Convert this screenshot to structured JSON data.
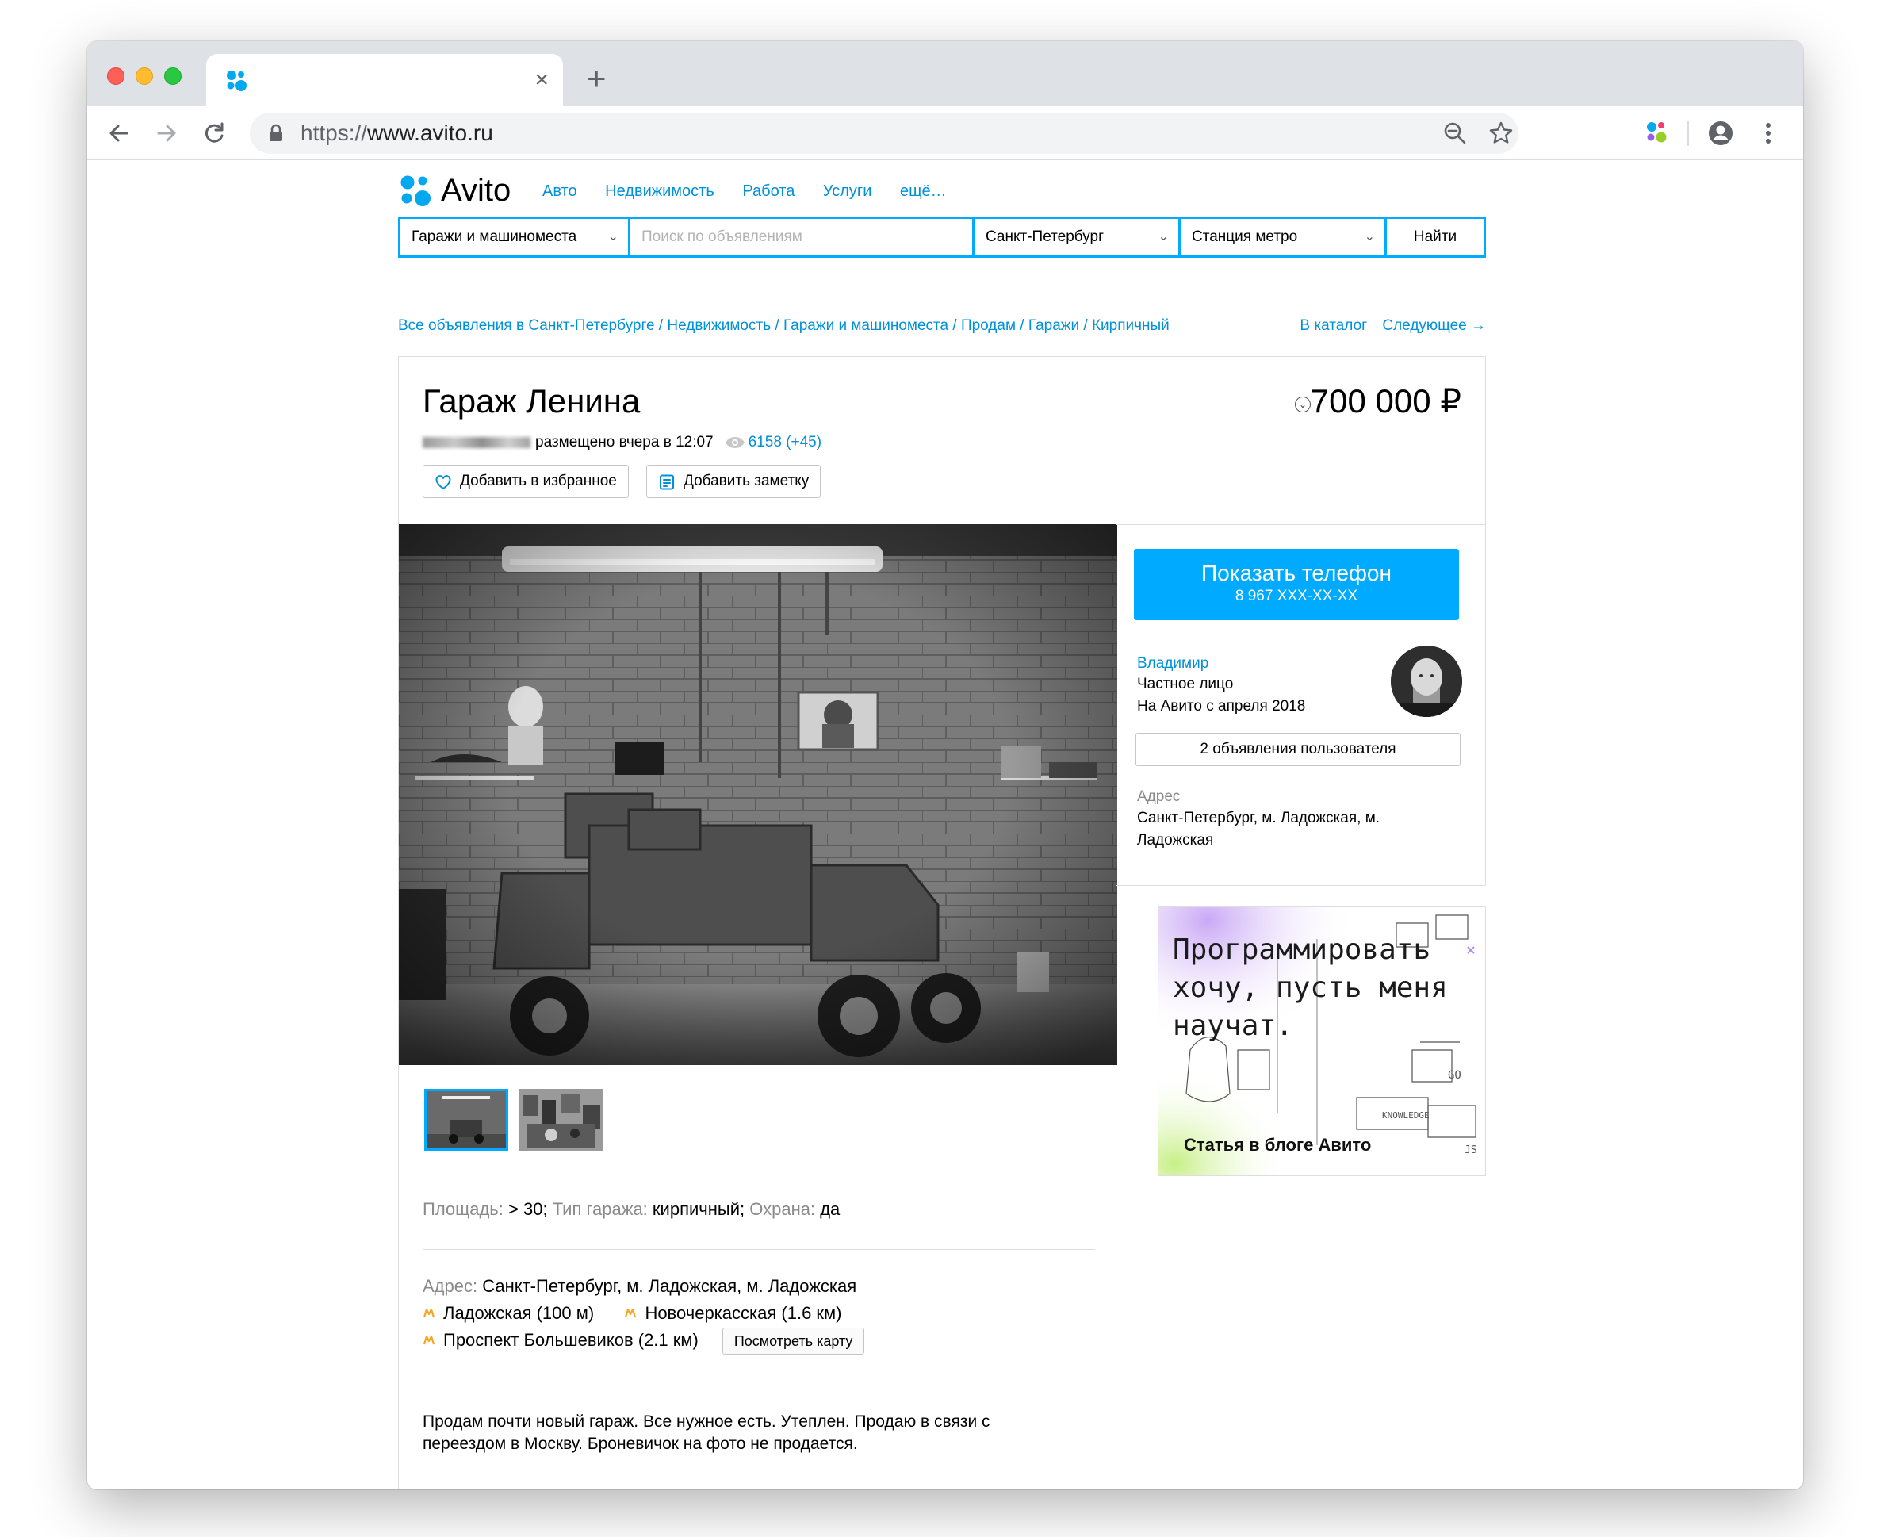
{
  "browser": {
    "url_protocol": "https://",
    "url_host": "www.avito.ru",
    "tab_close": "×",
    "new_tab": "+"
  },
  "header": {
    "logo_text": "Avito",
    "nav": [
      "Авто",
      "Недвижимость",
      "Работа",
      "Услуги",
      "ещё…"
    ]
  },
  "search": {
    "category": "Гаражи и машиноместа",
    "query_placeholder": "Поиск по объявлениям",
    "city": "Санкт-Петербург",
    "metro": "Станция метро",
    "submit": "Найти"
  },
  "breadcrumbs": [
    "Все объявления в Санкт-Петербурге",
    "Недвижимость",
    "Гаражи и машиноместа",
    "Продам",
    "Гаражи",
    "Кирпичный"
  ],
  "breadcrumb_sep": " / ",
  "catalog_links": {
    "catalog": "В каталог",
    "next": "Следующее →"
  },
  "listing": {
    "title": "Гараж Ленина",
    "price": "700 000 ₽",
    "posted": "размещено вчера в 12:07",
    "views": "6158 (+45)",
    "favorite_btn": "Добавить в избранное",
    "note_btn": "Добавить заметку",
    "params": [
      {
        "label": "Площадь:",
        "value": "> 30;"
      },
      {
        "label": "Тип гаража:",
        "value": "кирпичный;"
      },
      {
        "label": "Охрана:",
        "value": "да"
      }
    ],
    "address_label": "Адрес:",
    "address": "Санкт-Петербург, м. Ладожская, м. Ладожская",
    "metro_stations": [
      "Ладожская (100 м)",
      "Новочеркасская (1.6 км)",
      "Проспект Большевиков (2.1 км)"
    ],
    "map_btn": "Посмотреть карту",
    "description": "Продам почти новый гараж. Все нужное есть. Утеплен. Продаю в связи с переездом в Москву. Броневичок на фото не продается."
  },
  "seller": {
    "call_title": "Показать телефон",
    "call_phone": "8 967 XXX-XX-XX",
    "name": "Владимир",
    "type": "Частное лицо",
    "since": "На Авито с апреля 2018",
    "ads_btn": "2 объявления пользователя",
    "address_label": "Адрес",
    "address": "Санкт-Петербург, м. Ладожская, м. Ладожская"
  },
  "banner": {
    "headline": "Программировать хочу, пусть меня научат.",
    "footer": "Статья в блоге Авито",
    "box_labels": [
      "GO",
      "KNOWLEDGE",
      "JS"
    ]
  },
  "colors": {
    "accent": "#00aaff",
    "link": "#0091d9",
    "metro": "#f5a623"
  }
}
